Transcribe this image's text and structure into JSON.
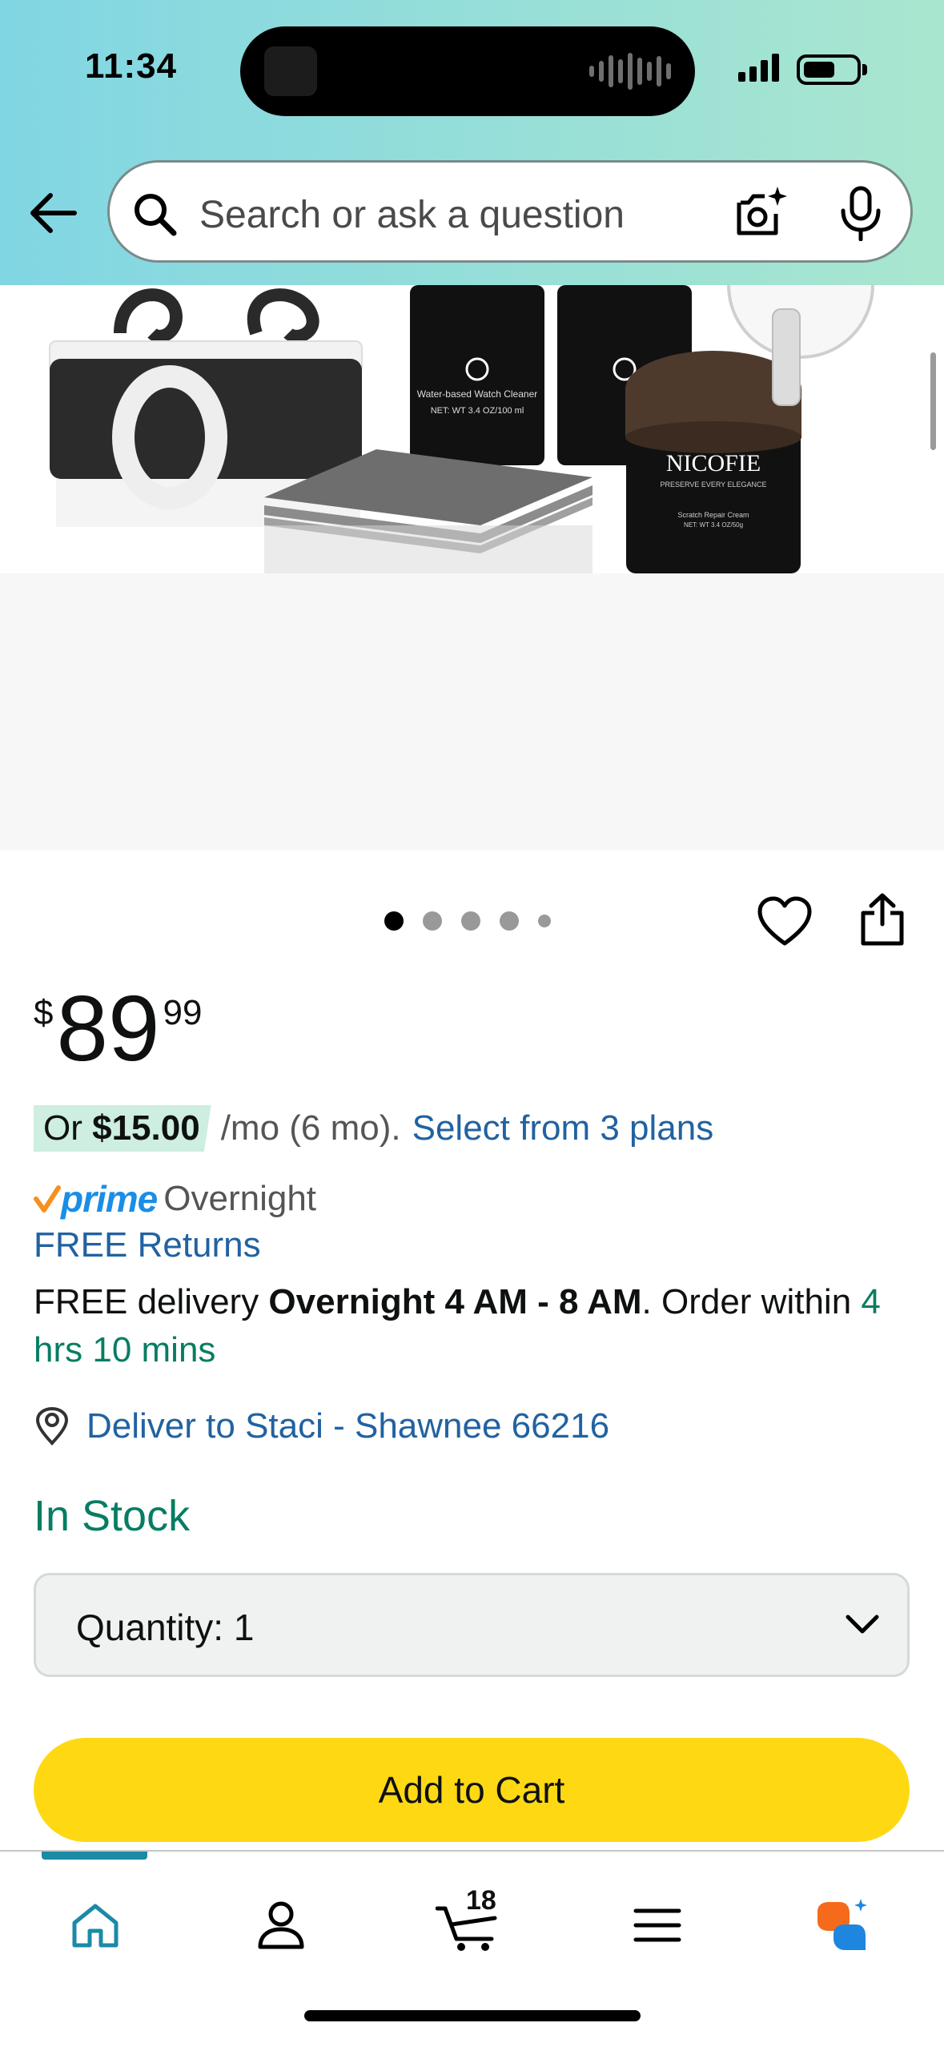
{
  "status_bar": {
    "time": "11:34"
  },
  "search": {
    "placeholder": "Search or ask a question"
  },
  "product_image": {
    "brand_text": "NICOFIE",
    "tagline": "PRESERVE EVERY ELEGANCE",
    "bottle_label_1": "Water-based Watch Cleaner",
    "bottle_net": "NET: WT 3.4 OZ/100 ml",
    "jar_label": "Scratch Repair Cream",
    "jar_net": "NET: WT 3.4 OZ/50g"
  },
  "carousel": {
    "count": 5,
    "active_index": 0
  },
  "price": {
    "symbol": "$",
    "whole": "89",
    "fraction": "99"
  },
  "installment": {
    "prefix": "Or ",
    "amount": "$15.00",
    "suffix": "/mo (6 mo).",
    "link": "Select from 3 plans"
  },
  "prime": {
    "word": "prime",
    "speed": "Overnight"
  },
  "returns": {
    "label": "FREE Returns"
  },
  "delivery": {
    "part1": "FREE delivery ",
    "bold": "Overnight 4 AM - 8 AM",
    "part2": ". Order within ",
    "countdown": "4 hrs 10 mins"
  },
  "deliver_to": {
    "label": "Deliver to Staci - Shawnee 66216"
  },
  "stock": {
    "label": "In Stock"
  },
  "quantity": {
    "label": "Quantity:",
    "value": "1"
  },
  "buttons": {
    "add_to_cart": "Add to Cart"
  },
  "nav": {
    "cart_count": "18"
  },
  "colors": {
    "accent_blue": "#2162a1",
    "stock_green": "#067d62",
    "cart_yellow": "#ffd814",
    "nav_active": "#1b8aa6"
  }
}
